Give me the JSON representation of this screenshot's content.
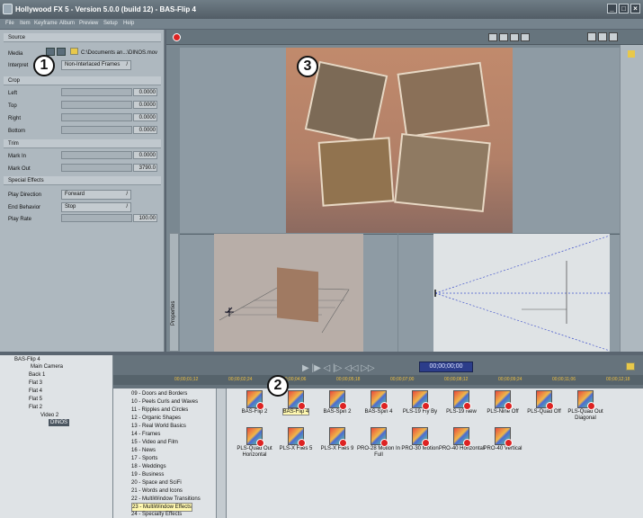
{
  "window": {
    "title": "Hollywood FX 5 - Version 5.0.0 (build 12) - BAS-Flip 4",
    "buttons": [
      "_",
      "□",
      "×"
    ]
  },
  "menu": [
    "File",
    "Item",
    "Keyframe",
    "Album",
    "Preview",
    "Setup",
    "Help"
  ],
  "source": {
    "header": "Source",
    "media_label": "Media",
    "media_path": "C:\\Documents an...\\DINOS.mov",
    "interpret_label": "Interpret",
    "interpret_value": "Non-Interlaced Frames"
  },
  "crop": {
    "header": "Crop",
    "rows": [
      {
        "label": "Left",
        "value": "0.0000"
      },
      {
        "label": "Top",
        "value": "0.0000"
      },
      {
        "label": "Right",
        "value": "0.0000"
      },
      {
        "label": "Bottom",
        "value": "0.0000"
      }
    ]
  },
  "trim": {
    "header": "Trim",
    "rows": [
      {
        "label": "Mark In",
        "value": "0.0000"
      },
      {
        "label": "Mark Out",
        "value": "3790.0"
      }
    ]
  },
  "special": {
    "header": "Special Effects",
    "play_direction_label": "Play Direction",
    "play_direction_value": "Forward",
    "end_behavior_label": "End Behavior",
    "end_behavior_value": "Stop",
    "play_rate_label": "Play Rate",
    "play_rate_value": "100.00"
  },
  "callouts": {
    "one": "1",
    "two": "2",
    "three": "3"
  },
  "props_label": "Properties",
  "tree": {
    "items": [
      {
        "label": "BAS-Flip 4",
        "indent": 0
      },
      {
        "label": "Main Camera",
        "indent": 1
      },
      {
        "label": "Back 1",
        "indent": 1
      },
      {
        "label": "Flat 3",
        "indent": 1
      },
      {
        "label": "Flat 4",
        "indent": 1
      },
      {
        "label": "Flat 5",
        "indent": 1
      },
      {
        "label": "Flat 2",
        "indent": 1
      },
      {
        "label": "Video 2",
        "indent": 2
      },
      {
        "label": "DINOS",
        "indent": 3
      }
    ]
  },
  "timecode": "00;00;00;00",
  "ruler": [
    "00;00;01;12",
    "00;00;02;24",
    "00;00;04;06",
    "00;00;05;18",
    "00;00;07;00",
    "00;00;08;12",
    "00;00;09;24",
    "00;00;11;06",
    "00;00;12;18"
  ],
  "categories": {
    "items": [
      "09 - Doors and Borders",
      "10 - Peels Curls and Waves",
      "11 - Ripples and Circles",
      "12 - Organic Shapes",
      "13 - Real World Basics",
      "14 - Frames",
      "15 - Video and Film",
      "16 - News",
      "17 - Sports",
      "18 - Weddings",
      "19 - Business",
      "20 - Space and SciFi",
      "21 - Words and Icons",
      "22 - MultiWindow Transitions",
      "23 - MultiWindow Effects",
      "24 - Specialty Effects"
    ],
    "selected_index": 14
  },
  "effects": {
    "row1": [
      "BAS-Flip 2",
      "BAS-Flip 4",
      "BAS-Spin 2",
      "BAS-Spin 4",
      "PLS-19 Fly By",
      "PLS-19 New",
      "PLS-Nine Off",
      "PLS-Quad Off",
      "PLS-Quad Out Diagonal"
    ],
    "row2": [
      "PLS-Quad Out Horizontal",
      "PLS-X Files 5",
      "PLS-X Files 9",
      "PRO-28 Motion In Full",
      "PRO-30 Motion",
      "PRO-40 Horizontal",
      "PRO-40 Vertical"
    ],
    "selected": "BAS-Flip 4"
  }
}
